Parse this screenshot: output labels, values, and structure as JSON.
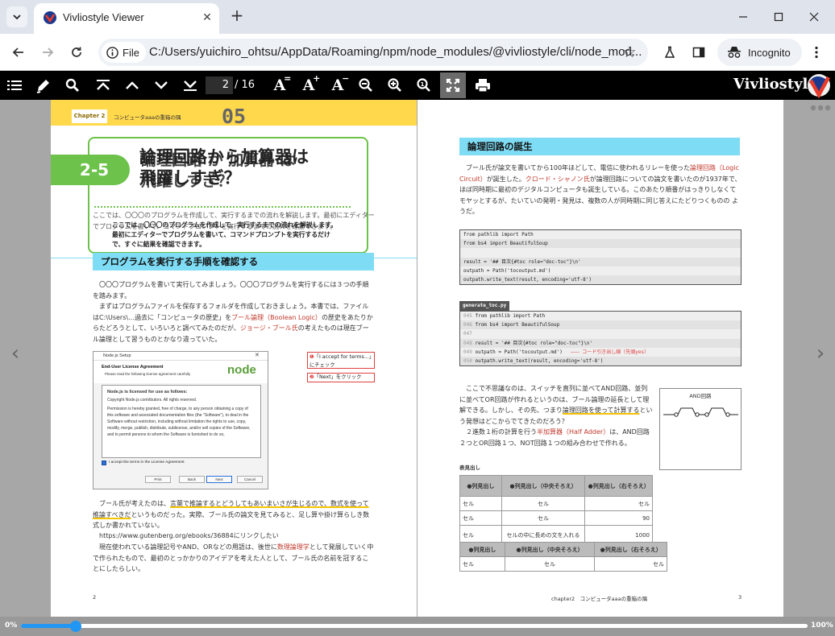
{
  "browser": {
    "tab_title": "Vivliostyle Viewer",
    "site_info_label": "File",
    "url": "C:/Users/yuichiro_ohtsu/AppData/Roaming/npm/node_modules/@vivliostyle/cli/node_mod...",
    "incognito_label": "Incognito"
  },
  "viewer": {
    "page_current": "2",
    "page_total": "/ 16",
    "brand": "Vivliostyle",
    "progress_min": "0%",
    "progress_max": "100%",
    "progress_value": 0.07,
    "accent_color": "#2196f3"
  },
  "left_page": {
    "chapter_tab": "Chapter 2",
    "chapter_title": "コンピュータaaaの重箱の隅",
    "chapter_number": "05",
    "section_number": "2-5",
    "section_title_a": "論理回路から加算器は",
    "section_title_b": "飛躍しすぎ？",
    "overlay_title_a": "論理回路 か 加算器 は",
    "overlay_title_b": "飛躍しすぎ？",
    "intro": "ここでは、〇〇〇のプログラムを作成して、実行するまでの流れを解説します。最初にエディターでプログラムを書いて、コマンドプロンプトを実行するまでの流れを確認できます。",
    "overlay_intro_1": "ここでは、〇〇〇のプログラムを作成して、実行するまでの流れを解説します。",
    "overlay_intro_2": "最初にエディターでプログラムを書いて、コマンドプロンプトを実行するだけ",
    "overlay_intro_3": "で、すぐに結果を確認できます。",
    "heading1": "プログラムを実行する手順を確認する",
    "para1": "〇〇〇プログラムを書いて実行してみましょう。〇〇〇プログラムを実行するには３つの手順を踏みます。",
    "para2_a": "まずはプログラムファイルを保存するフォルダを作成しておきましょう。本書では、ファイルはC:\\Users\\…過去に「コンピュータの歴史」を",
    "para2_red1": "ブール論理（Boolean Logic）",
    "para2_b": "の歴史をあたりからたどろうとして、いろいろと調べてみたのだが、",
    "para2_red2": "ジョージ・ブール氏",
    "para2_c": "の考えたものは現在ブール論理として習うものとかなり違っていた。",
    "installer": {
      "window_title": "Node.js Setup",
      "heading": "End-User License Agreement",
      "subheading": "Please read the following license agreement carefully",
      "box_title": "Node.js is licensed for use as follows:",
      "copyright": "Copyright Node.js contributors. All rights reserved.",
      "license_text": "Permission is hereby granted, free of charge, to any person obtaining a copy of this software and associated documentation files (the \"Software\"), to deal in the Software without restriction, including without limitation the rights to use, copy, modify, merge, publish, distribute, sublicense, and/or sell copies of the Software, and to permit persons to whom the Software is furnished to do so,",
      "accept": "I accept the terms in the License Agreement",
      "print": "Print",
      "back": "Back",
      "next": "Next",
      "cancel": "Cancel",
      "logo": "node"
    },
    "callout1": "「I accept for terms...」にチェック",
    "callout2": "「Next」をクリック",
    "para3_a": "ブール氏が考えたのは、",
    "para3_ul1": "言葉で推論するとどうしてもあいまいさが生じるので、数式を使って推論すべきだ",
    "para3_b": "というものだった。実際、ブール氏の論文を見てみると、足し算や掛け算らしき数式しか書かれていない。",
    "para4": "https://www.gutenberg.org/ebooks/36884にリンクしたい",
    "para5_a": "現在使われている論理記号やAND、ORなどの用語は、後世に",
    "para5_red": "数理論理学",
    "para5_b": "として発展していく中で作られたもので、最初のとっかかりのアイデアを考えた人として、ブール氏の名前を冠することにしたらしい。",
    "page_number": "2"
  },
  "right_page": {
    "heading": "論理回路の誕生",
    "para1_a": "ブール氏が論文を書いてから100年ほどして、電信に使われるリレーを使った",
    "para1_red1": "論理回路（Logic Circuit）",
    "para1_b": "が誕生した。",
    "para1_red2": "クロード・シャノン氏",
    "para1_c": "が論理回路についての論文を書いたのが1937年で、ほぼ同時期に最初のデジタルコンピュータも誕生している。このあたり順番がはっきりしなくてモヤッとするが、たいていの発明・発見は、複数の人が同時期に同じ答えにたどりつくものの ようだ。",
    "code1": [
      "from pathlib import Path",
      "from bs4 import BeautifulSoup",
      "",
      "result = '## 目次{#toc role=\"doc-toc\"}\\n'",
      "outpath = Path('tocoutput.md')",
      "outpath.write_text(result, encoding='utf-8')"
    ],
    "code2_label": "generate_toc.py",
    "code2": [
      {
        "ln": "045",
        "text": "from pathlib import Path",
        "note": ""
      },
      {
        "ln": "046",
        "text": "from bs4 import BeautifulSoup",
        "note": ""
      },
      {
        "ln": "047",
        "text": "",
        "note": ""
      },
      {
        "ln": "048",
        "text": "result = '## 目次{#toc role=\"doc-toc\"}\\n'",
        "note": ""
      },
      {
        "ln": "049",
        "text": "outpath = Path('tocoutput.md')",
        "note": "コード引き出し線（先頭yes）"
      },
      {
        "ln": "050",
        "text": "outpath.write_text(result, encoding='utf-8')",
        "note": ""
      }
    ],
    "para2_a": "ここで不思議なのは、スイッチを直列に並べてAND回路、並列に並べてOR回路が作れるというのは、ブール論理の延長として理解できる。しかし、その先、つまり",
    "para2_ul": "論理回路を使って計算する",
    "para2_b": "という発想はどこからでてきたのだろう？",
    "para3_a": "２進数１桁の計算を行う",
    "para3_red": "半加算器（Half Adder）",
    "para3_b": "は、AND回路２つとOR回路１つ、NOT回路１つの組み合わせで作れる。",
    "figure_label": "AND回路",
    "table_caption": "表見出し",
    "table1_header": [
      "●列見出し",
      "●列見出し（中央そろえ）",
      "●列見出し（右そろえ）"
    ],
    "table1_rows": [
      [
        "セル",
        "セル",
        "セル"
      ],
      [
        "セル",
        "セル",
        "90"
      ],
      [
        "セル",
        "セルの中に長めの文を入れる",
        "1000"
      ]
    ],
    "table2_header": [
      "●列見出し",
      "●列見出し（中央そろえ）",
      "●列見出し（右そろえ）"
    ],
    "table2_rows": [
      [
        "セル",
        "セル",
        "セル"
      ]
    ],
    "footer_title": "chapter2　コンピュータaaaの重箱の隅",
    "page_number": "3"
  }
}
